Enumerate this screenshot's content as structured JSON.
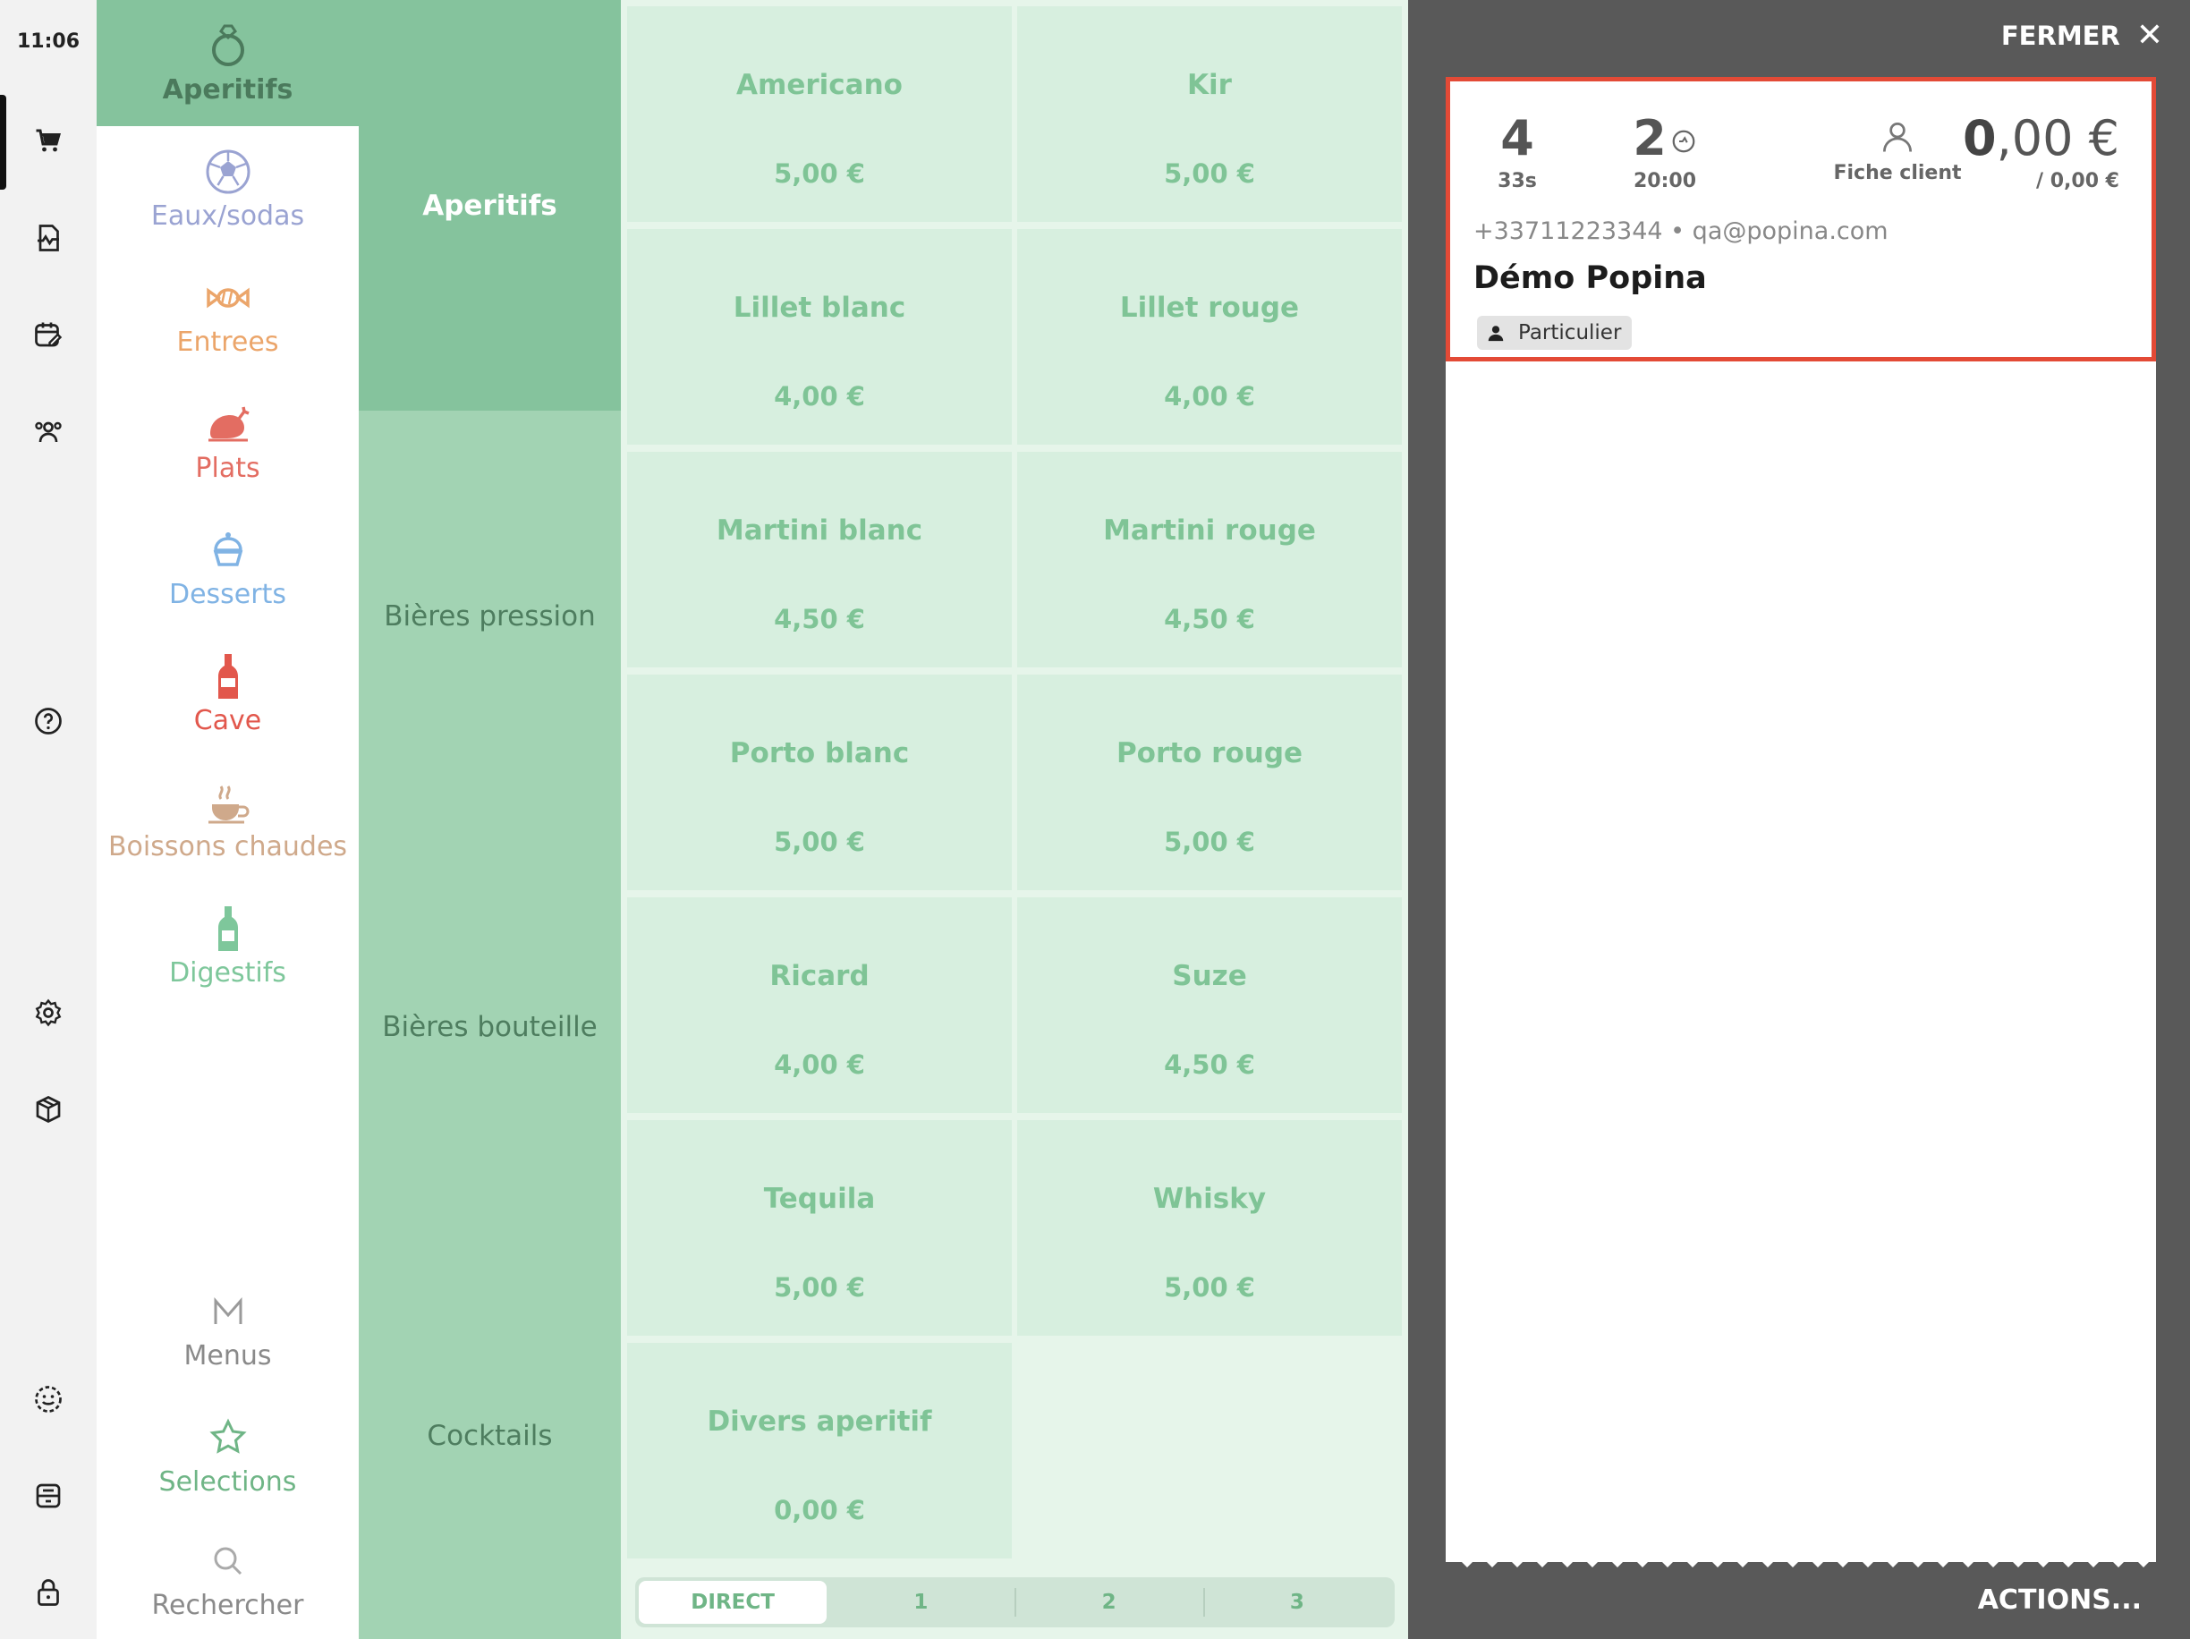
{
  "clock": "11:06",
  "rail": {
    "icons": [
      "cart-icon",
      "receipt-chart-icon",
      "calendar-edit-icon",
      "users-icon",
      "help-icon",
      "settings-icon",
      "package-icon",
      "smiley-icon",
      "drawer-icon",
      "lock-icon"
    ]
  },
  "families": [
    {
      "label": "Aperitifs",
      "icon": "ring-icon",
      "color": "#4b7a5c",
      "selected": true
    },
    {
      "label": "Eaux/sodas",
      "icon": "ball-icon",
      "color": "#9aa3d2"
    },
    {
      "label": "Entrees",
      "icon": "candy-icon",
      "color": "#eba56a"
    },
    {
      "label": "Plats",
      "icon": "roast-chicken-icon",
      "color": "#e36d62"
    },
    {
      "label": "Desserts",
      "icon": "cupcake-icon",
      "color": "#80b3e4"
    },
    {
      "label": "Cave",
      "icon": "wine-bottle-icon",
      "color": "#e2574c"
    },
    {
      "label": "Boissons chaudes",
      "icon": "coffee-cup-icon",
      "color": "#cfa98b"
    },
    {
      "label": "Digestifs",
      "icon": "liquor-bottle-icon",
      "color": "#7ec79b"
    }
  ],
  "extras": [
    {
      "label": "Menus",
      "icon": "menu-m-icon",
      "color": "#8a8a8a"
    },
    {
      "label": "Selections",
      "icon": "star-icon",
      "color": "#6fb586"
    },
    {
      "label": "Rechercher",
      "icon": "search-icon",
      "color": "#8a8a8a"
    }
  ],
  "categories": [
    {
      "label": "Aperitifs",
      "selected": true
    },
    {
      "label": "Bières pression"
    },
    {
      "label": "Bières bouteille"
    },
    {
      "label": "Cocktails"
    }
  ],
  "products": [
    {
      "name": "Americano",
      "price": "5,00 €"
    },
    {
      "name": "Kir",
      "price": "5,00 €"
    },
    {
      "name": "Lillet blanc",
      "price": "4,00 €"
    },
    {
      "name": "Lillet rouge",
      "price": "4,00 €"
    },
    {
      "name": "Martini blanc",
      "price": "4,50 €"
    },
    {
      "name": "Martini rouge",
      "price": "4,50 €"
    },
    {
      "name": "Porto blanc",
      "price": "5,00 €"
    },
    {
      "name": "Porto rouge",
      "price": "5,00 €"
    },
    {
      "name": "Ricard",
      "price": "4,00 €"
    },
    {
      "name": "Suze",
      "price": "4,50 €"
    },
    {
      "name": "Tequila",
      "price": "5,00 €"
    },
    {
      "name": "Whisky",
      "price": "5,00 €"
    },
    {
      "name": "Divers aperitif",
      "price": "0,00 €"
    }
  ],
  "tabs": [
    "DIRECT",
    "1",
    "2",
    "3"
  ],
  "panel": {
    "close_label": "FERMER",
    "actions_label": "ACTIONS...",
    "ticket": {
      "covers": "4",
      "elapsed": "33s",
      "service": "2",
      "service_time": "20:00",
      "customer_label": "Fiche client",
      "total_int": "0",
      "total_dec": ",00 €",
      "subtotal": "/ 0,00 €",
      "contact": "+33711223344 • qa@popina.com",
      "customer_name": "Démo Popina",
      "badge": "Particulier"
    }
  },
  "colors": {
    "selected_family": "#85c39d",
    "categories_bg": "#a2d3b3",
    "product_tile": "#d7efdf",
    "panel_bg": "#595959",
    "highlight_border": "#e34a36"
  }
}
